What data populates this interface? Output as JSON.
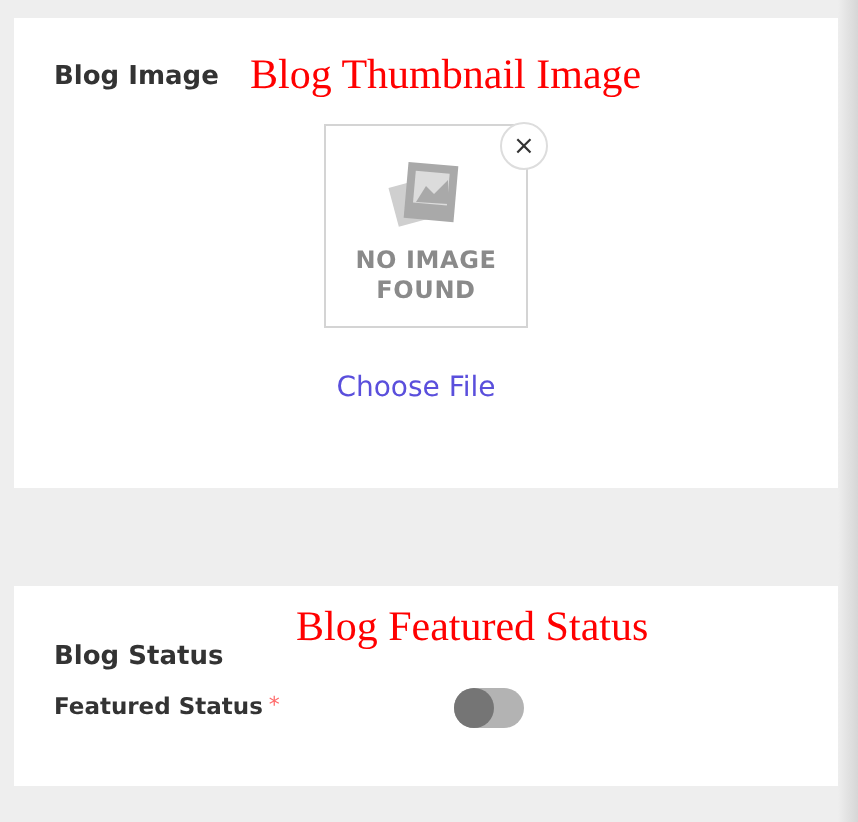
{
  "image_section": {
    "title": "Blog Image",
    "annotation": "Blog Thumbnail Image",
    "placeholder_text": [
      "NO IMAGE",
      "FOUND"
    ],
    "remove_button": "×",
    "choose_file": "Choose File"
  },
  "status_section": {
    "title": "Blog Status",
    "annotation": "Blog Featured Status",
    "field": {
      "label": "Featured Status",
      "required_mark": "*",
      "on": false
    }
  }
}
